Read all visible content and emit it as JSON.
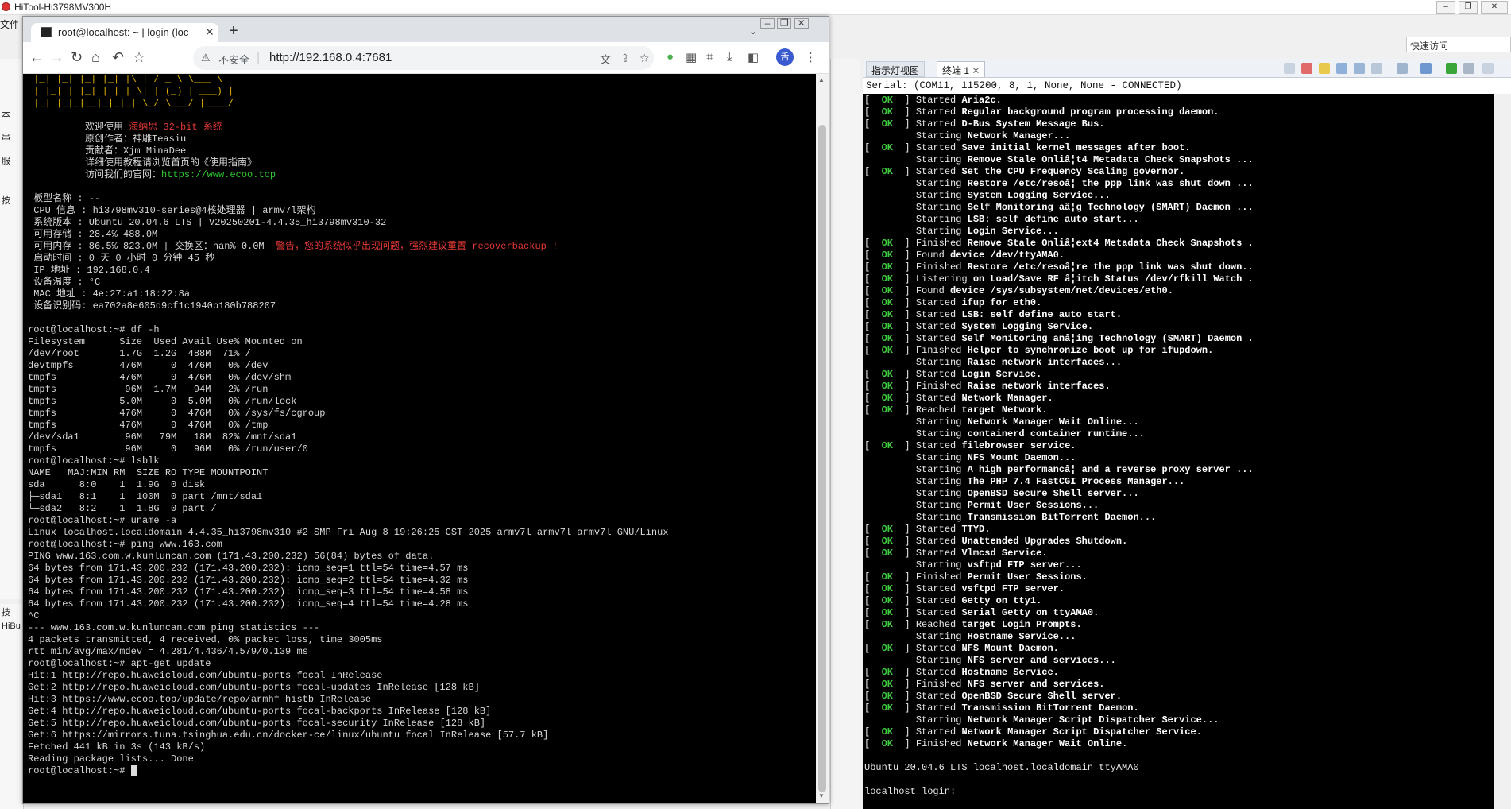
{
  "hitool": {
    "title": "HiTool-Hi3798MV300H",
    "menu_file": "文件",
    "quick_access": "快速访问",
    "left_strip": [
      "本",
      "串",
      "服",
      "按"
    ],
    "left_bottom": [
      "技",
      "HiBu"
    ]
  },
  "browser": {
    "tab_title": "root@localhost: ~ | login (loc",
    "insecure_label": "不安全",
    "url": "http://192.168.0.4:7681",
    "profile_initial": "舌"
  },
  "web_terminal": {
    "logo_lines": [
      " |_| |_| |_| |_| |\\ | / _ \\ \\___ \\",
      " | |_| | |_| | | | \\| | (_) | ___) |",
      " |_| |_|_|__|_|_|_| \\_/ \\___/ |____/"
    ],
    "welcome_prefix": "欢迎使用 ",
    "welcome_brand": "海纳思 32-bit 系统",
    "author": "原创作者：神雕Teasiu",
    "contributor": "贡献者：Xjm MinaDee",
    "guide": "详细使用教程请浏览首页的《使用指南》",
    "site_prefix": "访问我们的官网：",
    "site_url": "https://www.ecoo.top",
    "sysinfo": [
      " 板型名称 : --",
      " CPU 信息 : hi3798mv310-series@4核处理器 | armv7l架构",
      " 系统版本 : Ubuntu 20.04.6 LTS | V20250201-4.4.35_hi3798mv310-32",
      " 可用存储 : 28.4% 488.0M"
    ],
    "mem_line": " 可用内存 : 86.5% 823.0M | 交换区：nan% 0.0M",
    "mem_warning": "警告，您的系统似乎出现问题，强烈建议重置 recoverbackup !",
    "sysinfo2": [
      " 启动时间 : 0 天 0 小时 0 分钟 45 秒",
      " IP 地址 : 192.168.0.4",
      " 设备温度 : °C",
      " MAC 地址 : 4e:27:a1:18:22:8a",
      " 设备识别码: ea702a8e605d9cf1c1940b180b788207"
    ],
    "session": [
      "",
      "root@localhost:~# df -h",
      "Filesystem      Size  Used Avail Use% Mounted on",
      "/dev/root       1.7G  1.2G  488M  71% /",
      "devtmpfs        476M     0  476M   0% /dev",
      "tmpfs           476M     0  476M   0% /dev/shm",
      "tmpfs            96M  1.7M   94M   2% /run",
      "tmpfs           5.0M     0  5.0M   0% /run/lock",
      "tmpfs           476M     0  476M   0% /sys/fs/cgroup",
      "tmpfs           476M     0  476M   0% /tmp",
      "/dev/sda1        96M   79M   18M  82% /mnt/sda1",
      "tmpfs            96M     0   96M   0% /run/user/0",
      "root@localhost:~# lsblk",
      "NAME   MAJ:MIN RM  SIZE RO TYPE MOUNTPOINT",
      "sda      8:0    1  1.9G  0 disk",
      "├─sda1   8:1    1  100M  0 part /mnt/sda1",
      "└─sda2   8:2    1  1.8G  0 part /",
      "root@localhost:~# uname -a",
      "Linux localhost.localdomain 4.4.35_hi3798mv310 #2 SMP Fri Aug 8 19:26:25 CST 2025 armv7l armv7l armv7l GNU/Linux",
      "root@localhost:~# ping www.163.com",
      "PING www.163.com.w.kunluncan.com (171.43.200.232) 56(84) bytes of data.",
      "64 bytes from 171.43.200.232 (171.43.200.232): icmp_seq=1 ttl=54 time=4.57 ms",
      "64 bytes from 171.43.200.232 (171.43.200.232): icmp_seq=2 ttl=54 time=4.32 ms",
      "64 bytes from 171.43.200.232 (171.43.200.232): icmp_seq=3 ttl=54 time=4.58 ms",
      "64 bytes from 171.43.200.232 (171.43.200.232): icmp_seq=4 ttl=54 time=4.28 ms",
      "^C",
      "--- www.163.com.w.kunluncan.com ping statistics ---",
      "4 packets transmitted, 4 received, 0% packet loss, time 3005ms",
      "rtt min/avg/max/mdev = 4.281/4.436/4.579/0.139 ms",
      "root@localhost:~# apt-get update",
      "Hit:1 http://repo.huaweicloud.com/ubuntu-ports focal InRelease",
      "Get:2 http://repo.huaweicloud.com/ubuntu-ports focal-updates InRelease [128 kB]",
      "Hit:3 https://www.ecoo.top/update/repo/armhf histb InRelease",
      "Get:4 http://repo.huaweicloud.com/ubuntu-ports focal-backports InRelease [128 kB]",
      "Get:5 http://repo.huaweicloud.com/ubuntu-ports focal-security InRelease [128 kB]",
      "Get:6 https://mirrors.tuna.tsinghua.edu.cn/docker-ce/linux/ubuntu focal InRelease [57.7 kB]",
      "Fetched 441 kB in 3s (143 kB/s)",
      "Reading package lists... Done"
    ],
    "prompt": "root@localhost:~# "
  },
  "right_pane": {
    "tab_indicator": "指示灯视图",
    "tab_terminal": "终端 1",
    "serial_status": "Serial: (COM11, 115200, 8, 1, None, None - CONNECTED)",
    "ok_text": " OK ",
    "boot_lines": [
      {
        "ok": true,
        "verb": "Started",
        "rest": "Aria2c."
      },
      {
        "ok": true,
        "verb": "Started",
        "rest": "Regular background program processing daemon."
      },
      {
        "ok": true,
        "verb": "Started",
        "rest": "D-Bus System Message Bus."
      },
      {
        "ok": false,
        "verb": "Starting",
        "rest": "Network Manager..."
      },
      {
        "ok": true,
        "verb": "Started",
        "rest": "Save initial kernel messages after boot."
      },
      {
        "ok": false,
        "verb": "Starting",
        "rest": "Remove Stale Onliâ¦t4 Metadata Check Snapshots ..."
      },
      {
        "ok": true,
        "verb": "Started",
        "rest": "Set the CPU Frequency Scaling governor."
      },
      {
        "ok": false,
        "verb": "Starting",
        "rest": "Restore /etc/resoâ¦ the ppp link was shut down ..."
      },
      {
        "ok": false,
        "verb": "Starting",
        "rest": "System Logging Service..."
      },
      {
        "ok": false,
        "verb": "Starting",
        "rest": "Self Monitoring aâ¦g Technology (SMART) Daemon ..."
      },
      {
        "ok": false,
        "verb": "Starting",
        "rest": "LSB: self define auto start..."
      },
      {
        "ok": false,
        "verb": "Starting",
        "rest": "Login Service..."
      },
      {
        "ok": true,
        "verb": "Finished",
        "rest": "Remove Stale Onliâ¦ext4 Metadata Check Snapshots ."
      },
      {
        "ok": true,
        "verb": "Found",
        "rest": "device /dev/ttyAMA0."
      },
      {
        "ok": true,
        "verb": "Finished",
        "rest": "Restore /etc/resoâ¦re the ppp link was shut down.."
      },
      {
        "ok": true,
        "verb": "Listening",
        "rest": "on Load/Save RF â¦itch Status /dev/rfkill Watch ."
      },
      {
        "ok": true,
        "verb": "Found",
        "rest": "device /sys/subsystem/net/devices/eth0."
      },
      {
        "ok": true,
        "verb": "Started",
        "rest": "ifup for eth0."
      },
      {
        "ok": true,
        "verb": "Started",
        "rest": "LSB: self define auto start."
      },
      {
        "ok": true,
        "verb": "Started",
        "rest": "System Logging Service."
      },
      {
        "ok": true,
        "verb": "Started",
        "rest": "Self Monitoring anâ¦ing Technology (SMART) Daemon ."
      },
      {
        "ok": true,
        "verb": "Finished",
        "rest": "Helper to synchronize boot up for ifupdown."
      },
      {
        "ok": false,
        "verb": "Starting",
        "rest": "Raise network interfaces..."
      },
      {
        "ok": true,
        "verb": "Started",
        "rest": "Login Service."
      },
      {
        "ok": true,
        "verb": "Finished",
        "rest": "Raise network interfaces."
      },
      {
        "ok": true,
        "verb": "Started",
        "rest": "Network Manager."
      },
      {
        "ok": true,
        "verb": "Reached",
        "rest": "target Network."
      },
      {
        "ok": false,
        "verb": "Starting",
        "rest": "Network Manager Wait Online..."
      },
      {
        "ok": false,
        "verb": "Starting",
        "rest": "containerd container runtime..."
      },
      {
        "ok": true,
        "verb": "Started",
        "rest": "filebrowser service."
      },
      {
        "ok": false,
        "verb": "Starting",
        "rest": "NFS Mount Daemon..."
      },
      {
        "ok": false,
        "verb": "Starting",
        "rest": "A high performancâ¦ and a reverse proxy server ..."
      },
      {
        "ok": false,
        "verb": "Starting",
        "rest": "The PHP 7.4 FastCGI Process Manager..."
      },
      {
        "ok": false,
        "verb": "Starting",
        "rest": "OpenBSD Secure Shell server..."
      },
      {
        "ok": false,
        "verb": "Starting",
        "rest": "Permit User Sessions..."
      },
      {
        "ok": false,
        "verb": "Starting",
        "rest": "Transmission BitTorrent Daemon..."
      },
      {
        "ok": true,
        "verb": "Started",
        "rest": "TTYD."
      },
      {
        "ok": true,
        "verb": "Started",
        "rest": "Unattended Upgrades Shutdown."
      },
      {
        "ok": true,
        "verb": "Started",
        "rest": "Vlmcsd Service."
      },
      {
        "ok": false,
        "verb": "Starting",
        "rest": "vsftpd FTP server..."
      },
      {
        "ok": true,
        "verb": "Finished",
        "rest": "Permit User Sessions."
      },
      {
        "ok": true,
        "verb": "Started",
        "rest": "vsftpd FTP server."
      },
      {
        "ok": true,
        "verb": "Started",
        "rest": "Getty on tty1."
      },
      {
        "ok": true,
        "verb": "Started",
        "rest": "Serial Getty on ttyAMA0."
      },
      {
        "ok": true,
        "verb": "Reached",
        "rest": "target Login Prompts."
      },
      {
        "ok": false,
        "verb": "Starting",
        "rest": "Hostname Service..."
      },
      {
        "ok": true,
        "verb": "Started",
        "rest": "NFS Mount Daemon."
      },
      {
        "ok": false,
        "verb": "Starting",
        "rest": "NFS server and services..."
      },
      {
        "ok": true,
        "verb": "Started",
        "rest": "Hostname Service."
      },
      {
        "ok": true,
        "verb": "Finished",
        "rest": "NFS server and services."
      },
      {
        "ok": true,
        "verb": "Started",
        "rest": "OpenBSD Secure Shell server."
      },
      {
        "ok": true,
        "verb": "Started",
        "rest": "Transmission BitTorrent Daemon."
      },
      {
        "ok": false,
        "verb": "Starting",
        "rest": "Network Manager Script Dispatcher Service..."
      },
      {
        "ok": true,
        "verb": "Started",
        "rest": "Network Manager Script Dispatcher Service."
      },
      {
        "ok": true,
        "verb": "Finished",
        "rest": "Network Manager Wait Online."
      }
    ],
    "banner": "Ubuntu 20.04.6 LTS localhost.localdomain ttyAMA0",
    "login_prompt": "localhost login: "
  },
  "colors": {
    "ok_green": "#3ec93e",
    "warn_red": "#e53935",
    "logo_yellow": "#e0b000",
    "link_green": "#2ec72e"
  }
}
